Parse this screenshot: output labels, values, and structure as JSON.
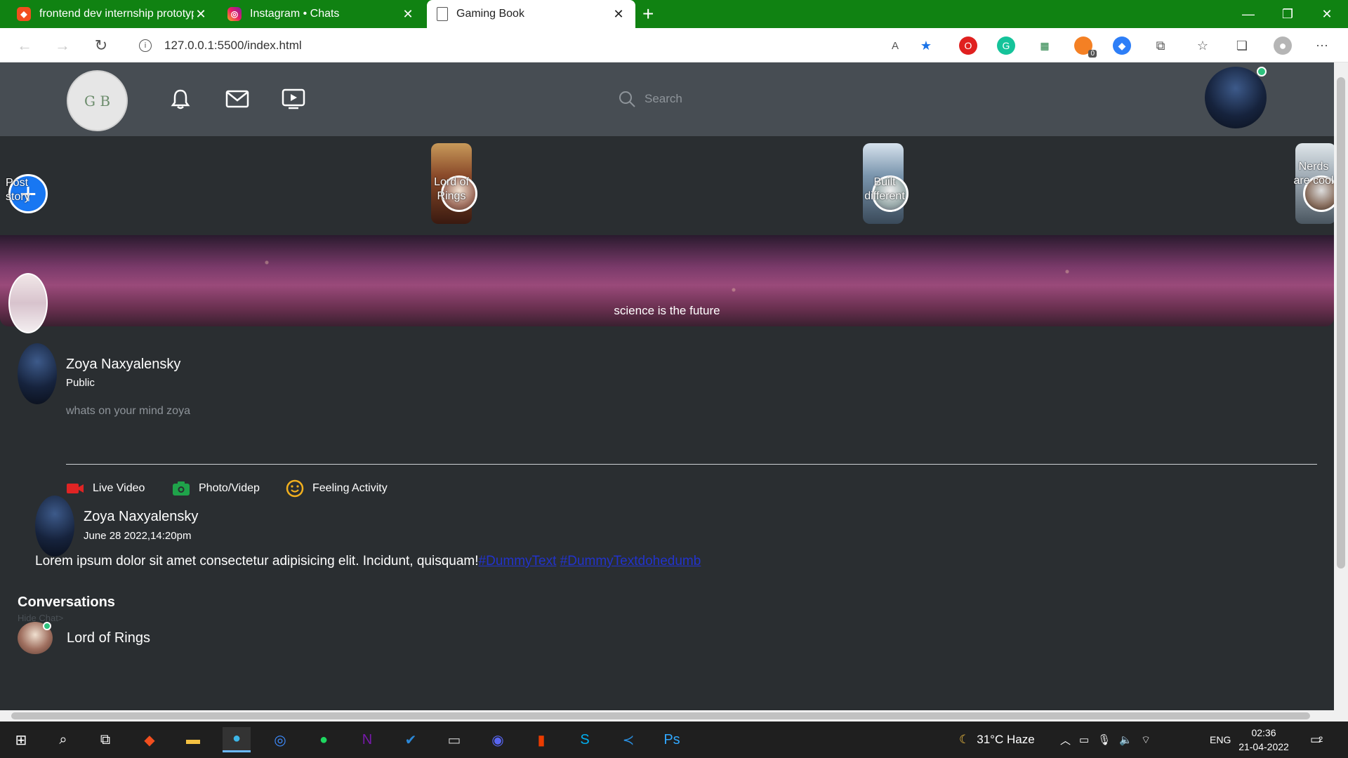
{
  "browser": {
    "tabs": [
      {
        "label": "frontend dev internship prototyp",
        "icon": "figma-icon"
      },
      {
        "label": "Instagram • Chats",
        "icon": "instagram-icon"
      },
      {
        "label": "Gaming Book",
        "icon": "page-icon"
      }
    ],
    "url": "127.0.0.1:5500/index.html",
    "extension_badge": "0"
  },
  "header": {
    "logo_text": "G B",
    "search_placeholder": "Search"
  },
  "stories": {
    "post_label": "Post story",
    "items": [
      {
        "label": "Lord of Rings"
      },
      {
        "label": "Built different"
      },
      {
        "label": "Nerds are cool"
      }
    ]
  },
  "banner": {
    "caption": "science is the future"
  },
  "composer": {
    "name": "Zoya Naxyalensky",
    "visibility": "Public",
    "placeholder": "whats on your mind zoya",
    "actions": [
      {
        "label": "Live Video",
        "color": "#e02424"
      },
      {
        "label": "Photo/Videp",
        "color": "#1fa34a"
      },
      {
        "label": "Feeling Activity",
        "color": "#f2b01e"
      }
    ]
  },
  "post": {
    "name": "Zoya Naxyalensky",
    "date": "June 28 2022,14:20pm",
    "text": "Lorem ipsum dolor sit amet consectetur adipisicing elit. Incidunt, quisquam!",
    "tags": [
      "#DummyText",
      "#DummyTextdohedumb"
    ]
  },
  "conversations": {
    "title": "Conversations",
    "hide_label": "Hide Chat>",
    "items": [
      {
        "name": "Lord of Rings"
      }
    ]
  },
  "taskbar": {
    "weather": "31°C  Haze",
    "lang": "ENG",
    "time": "02:36",
    "date": "21-04-2022",
    "notification_count": "2"
  }
}
